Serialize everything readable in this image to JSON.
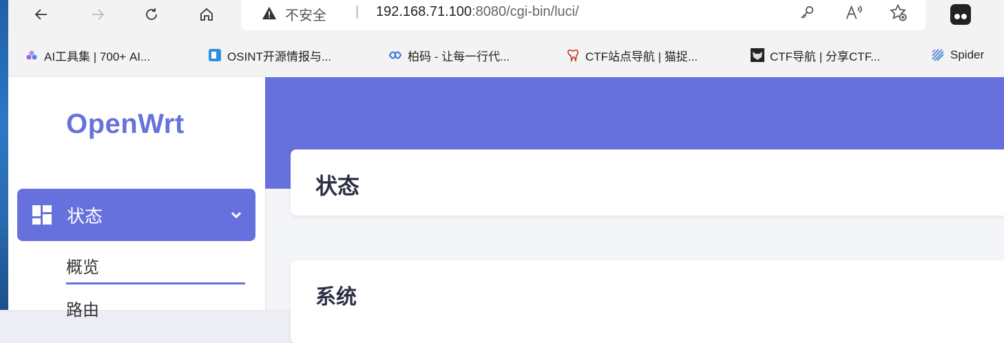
{
  "browser": {
    "security_label": "不安全",
    "separator": "|",
    "url_host": "192.168.71.100",
    "url_rest": ":8080/cgi-bin/luci/"
  },
  "icons": {
    "back": "arrow-left-icon",
    "forward": "arrow-right-icon",
    "reload": "reload-icon",
    "home": "home-icon",
    "warning": "warning-icon",
    "key": "key-icon",
    "read_aloud": "read-aloud-icon",
    "favorite": "favorite-add-icon",
    "extension": "extension-icon"
  },
  "bookmarks": [
    {
      "label": "AI工具集 | 700+ AI...",
      "icon": "ai-tools-icon",
      "color": "#7b61c9"
    },
    {
      "label": "OSINT开源情报与...",
      "icon": "osint-icon",
      "color": "#2f8fe0"
    },
    {
      "label": "柏码 - 让每一行代...",
      "icon": "baima-icon",
      "color": "#3b6fd6"
    },
    {
      "label": "CTF站点导航 | 猫捉...",
      "icon": "tooth-icon",
      "color": "#c0392b"
    },
    {
      "label": "CTF导航 | 分享CTF...",
      "icon": "ctf-mask-icon",
      "color": "#222222"
    },
    {
      "label": "Spider",
      "icon": "spider-icon",
      "color": "#5a8de0"
    }
  ],
  "sidebar": {
    "logo": "OpenWrt",
    "active_menu": "状态",
    "sub_items": [
      "概览",
      "路由"
    ]
  },
  "main": {
    "page_title": "状态",
    "section_title": "系统"
  },
  "colors": {
    "accent": "#6671dd",
    "banner": "#6671dd"
  }
}
